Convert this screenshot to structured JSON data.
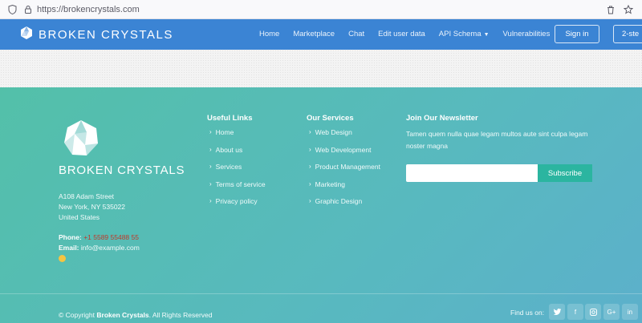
{
  "browser": {
    "url": "https://brokencrystals.com"
  },
  "header": {
    "brand": "BROKEN CRYSTALS",
    "nav": [
      "Home",
      "Marketplace",
      "Chat",
      "Edit user data",
      "API Schema",
      "Vulnerabilities"
    ],
    "signin_label": "Sign in",
    "twostep_label": "2-ste"
  },
  "footer": {
    "brand": "BROKEN CRYSTALS",
    "address": [
      "A108 Adam Street",
      "New York, NY 535022",
      "United States"
    ],
    "phone_label": "Phone:",
    "phone_value": "+1 5589 55488 55",
    "email_label": "Email:",
    "email_value": "info@example.com",
    "useful_links": {
      "title": "Useful Links",
      "items": [
        "Home",
        "About us",
        "Services",
        "Terms of service",
        "Privacy policy"
      ]
    },
    "services": {
      "title": "Our Services",
      "items": [
        "Web Design",
        "Web Development",
        "Product Management",
        "Marketing",
        "Graphic Design"
      ]
    },
    "newsletter": {
      "title": "Join Our Newsletter",
      "text": "Tamen quem nulla quae legam multos aute sint culpa legam noster magna",
      "input_value": "",
      "button_label": "Subscribe"
    },
    "copyright_prefix": "© Copyright",
    "copyright_brand": "Broken Crystals",
    "copyright_suffix": ". All Rights Reserved",
    "findus_label": "Find us on:",
    "social": [
      {
        "icon": "twitter-icon",
        "glyph": "𝕥"
      },
      {
        "icon": "facebook-icon",
        "glyph": "f"
      },
      {
        "icon": "instagram-icon",
        "glyph": "◎"
      },
      {
        "icon": "google-plus-icon",
        "glyph": "G+"
      },
      {
        "icon": "linkedin-icon",
        "glyph": "in"
      }
    ]
  },
  "colors": {
    "header_bg": "#3b84d4",
    "footer_gradient_start": "#53c0a9",
    "footer_gradient_end": "#5cb0cb",
    "subscribe_bg": "#2bb5a0",
    "phone_color": "#c0392b"
  }
}
